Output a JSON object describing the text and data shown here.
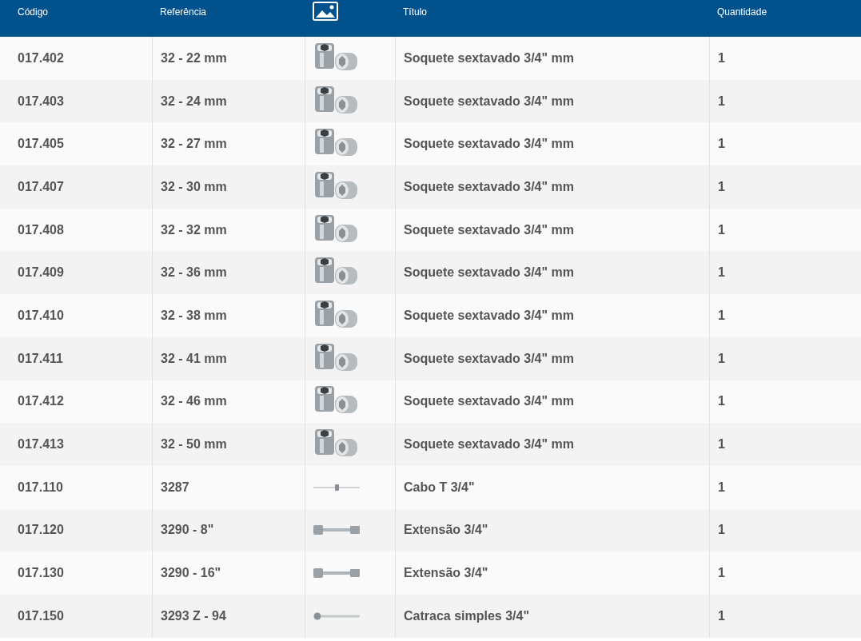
{
  "table": {
    "columns": [
      {
        "label": "Código",
        "kind": "text"
      },
      {
        "label": "Referência",
        "kind": "text"
      },
      {
        "kind": "image"
      },
      {
        "label": "Título",
        "kind": "text"
      },
      {
        "label": "Quantidade",
        "kind": "text"
      }
    ],
    "rows": [
      {
        "code": "017.402",
        "reference": "32 - 22 mm",
        "kind": "socket",
        "title": "Soquete sextavado 3/4\" mm",
        "quantity": "1"
      },
      {
        "code": "017.403",
        "reference": "32 - 24 mm",
        "kind": "socket",
        "title": "Soquete sextavado 3/4\" mm",
        "quantity": "1"
      },
      {
        "code": "017.405",
        "reference": "32 - 27 mm",
        "kind": "socket",
        "title": "Soquete sextavado 3/4\" mm",
        "quantity": "1"
      },
      {
        "code": "017.407",
        "reference": "32 - 30 mm",
        "kind": "socket",
        "title": "Soquete sextavado 3/4\" mm",
        "quantity": "1"
      },
      {
        "code": "017.408",
        "reference": "32 - 32 mm",
        "kind": "socket",
        "title": "Soquete sextavado 3/4\" mm",
        "quantity": "1"
      },
      {
        "code": "017.409",
        "reference": "32 - 36 mm",
        "kind": "socket",
        "title": "Soquete sextavado 3/4\" mm",
        "quantity": "1"
      },
      {
        "code": "017.410",
        "reference": "32 - 38 mm",
        "kind": "socket",
        "title": "Soquete sextavado 3/4\" mm",
        "quantity": "1"
      },
      {
        "code": "017.411",
        "reference": "32 - 41 mm",
        "kind": "socket",
        "title": "Soquete sextavado 3/4\" mm",
        "quantity": "1"
      },
      {
        "code": "017.412",
        "reference": "32 - 46 mm",
        "kind": "socket",
        "title": "Soquete sextavado 3/4\" mm",
        "quantity": "1"
      },
      {
        "code": "017.413",
        "reference": "32 - 50 mm",
        "kind": "socket",
        "title": "Soquete sextavado 3/4\" mm",
        "quantity": "1"
      },
      {
        "code": "017.110",
        "reference": "3287",
        "kind": "t-handle",
        "title": "Cabo T 3/4\"",
        "quantity": "1"
      },
      {
        "code": "017.120",
        "reference": "3290 - 8\"",
        "kind": "extension",
        "title": "Extensão 3/4\"",
        "quantity": "1"
      },
      {
        "code": "017.130",
        "reference": "3290 - 16\"",
        "kind": "extension",
        "title": "Extensão 3/4\"",
        "quantity": "1"
      },
      {
        "code": "017.150",
        "reference": "3293 Z - 94",
        "kind": "ratchet",
        "title": "Catraca simples 3/4\"",
        "quantity": "1"
      }
    ]
  }
}
